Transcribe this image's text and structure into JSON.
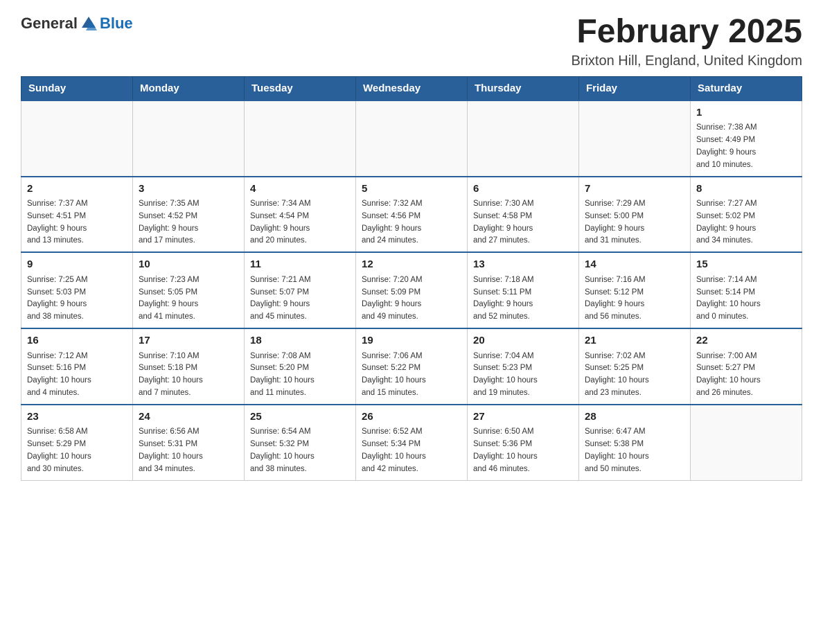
{
  "header": {
    "logo_general": "General",
    "logo_blue": "Blue",
    "title": "February 2025",
    "subtitle": "Brixton Hill, England, United Kingdom"
  },
  "weekdays": [
    "Sunday",
    "Monday",
    "Tuesday",
    "Wednesday",
    "Thursday",
    "Friday",
    "Saturday"
  ],
  "weeks": [
    [
      {
        "day": "",
        "info": ""
      },
      {
        "day": "",
        "info": ""
      },
      {
        "day": "",
        "info": ""
      },
      {
        "day": "",
        "info": ""
      },
      {
        "day": "",
        "info": ""
      },
      {
        "day": "",
        "info": ""
      },
      {
        "day": "1",
        "info": "Sunrise: 7:38 AM\nSunset: 4:49 PM\nDaylight: 9 hours\nand 10 minutes."
      }
    ],
    [
      {
        "day": "2",
        "info": "Sunrise: 7:37 AM\nSunset: 4:51 PM\nDaylight: 9 hours\nand 13 minutes."
      },
      {
        "day": "3",
        "info": "Sunrise: 7:35 AM\nSunset: 4:52 PM\nDaylight: 9 hours\nand 17 minutes."
      },
      {
        "day": "4",
        "info": "Sunrise: 7:34 AM\nSunset: 4:54 PM\nDaylight: 9 hours\nand 20 minutes."
      },
      {
        "day": "5",
        "info": "Sunrise: 7:32 AM\nSunset: 4:56 PM\nDaylight: 9 hours\nand 24 minutes."
      },
      {
        "day": "6",
        "info": "Sunrise: 7:30 AM\nSunset: 4:58 PM\nDaylight: 9 hours\nand 27 minutes."
      },
      {
        "day": "7",
        "info": "Sunrise: 7:29 AM\nSunset: 5:00 PM\nDaylight: 9 hours\nand 31 minutes."
      },
      {
        "day": "8",
        "info": "Sunrise: 7:27 AM\nSunset: 5:02 PM\nDaylight: 9 hours\nand 34 minutes."
      }
    ],
    [
      {
        "day": "9",
        "info": "Sunrise: 7:25 AM\nSunset: 5:03 PM\nDaylight: 9 hours\nand 38 minutes."
      },
      {
        "day": "10",
        "info": "Sunrise: 7:23 AM\nSunset: 5:05 PM\nDaylight: 9 hours\nand 41 minutes."
      },
      {
        "day": "11",
        "info": "Sunrise: 7:21 AM\nSunset: 5:07 PM\nDaylight: 9 hours\nand 45 minutes."
      },
      {
        "day": "12",
        "info": "Sunrise: 7:20 AM\nSunset: 5:09 PM\nDaylight: 9 hours\nand 49 minutes."
      },
      {
        "day": "13",
        "info": "Sunrise: 7:18 AM\nSunset: 5:11 PM\nDaylight: 9 hours\nand 52 minutes."
      },
      {
        "day": "14",
        "info": "Sunrise: 7:16 AM\nSunset: 5:12 PM\nDaylight: 9 hours\nand 56 minutes."
      },
      {
        "day": "15",
        "info": "Sunrise: 7:14 AM\nSunset: 5:14 PM\nDaylight: 10 hours\nand 0 minutes."
      }
    ],
    [
      {
        "day": "16",
        "info": "Sunrise: 7:12 AM\nSunset: 5:16 PM\nDaylight: 10 hours\nand 4 minutes."
      },
      {
        "day": "17",
        "info": "Sunrise: 7:10 AM\nSunset: 5:18 PM\nDaylight: 10 hours\nand 7 minutes."
      },
      {
        "day": "18",
        "info": "Sunrise: 7:08 AM\nSunset: 5:20 PM\nDaylight: 10 hours\nand 11 minutes."
      },
      {
        "day": "19",
        "info": "Sunrise: 7:06 AM\nSunset: 5:22 PM\nDaylight: 10 hours\nand 15 minutes."
      },
      {
        "day": "20",
        "info": "Sunrise: 7:04 AM\nSunset: 5:23 PM\nDaylight: 10 hours\nand 19 minutes."
      },
      {
        "day": "21",
        "info": "Sunrise: 7:02 AM\nSunset: 5:25 PM\nDaylight: 10 hours\nand 23 minutes."
      },
      {
        "day": "22",
        "info": "Sunrise: 7:00 AM\nSunset: 5:27 PM\nDaylight: 10 hours\nand 26 minutes."
      }
    ],
    [
      {
        "day": "23",
        "info": "Sunrise: 6:58 AM\nSunset: 5:29 PM\nDaylight: 10 hours\nand 30 minutes."
      },
      {
        "day": "24",
        "info": "Sunrise: 6:56 AM\nSunset: 5:31 PM\nDaylight: 10 hours\nand 34 minutes."
      },
      {
        "day": "25",
        "info": "Sunrise: 6:54 AM\nSunset: 5:32 PM\nDaylight: 10 hours\nand 38 minutes."
      },
      {
        "day": "26",
        "info": "Sunrise: 6:52 AM\nSunset: 5:34 PM\nDaylight: 10 hours\nand 42 minutes."
      },
      {
        "day": "27",
        "info": "Sunrise: 6:50 AM\nSunset: 5:36 PM\nDaylight: 10 hours\nand 46 minutes."
      },
      {
        "day": "28",
        "info": "Sunrise: 6:47 AM\nSunset: 5:38 PM\nDaylight: 10 hours\nand 50 minutes."
      },
      {
        "day": "",
        "info": ""
      }
    ]
  ]
}
